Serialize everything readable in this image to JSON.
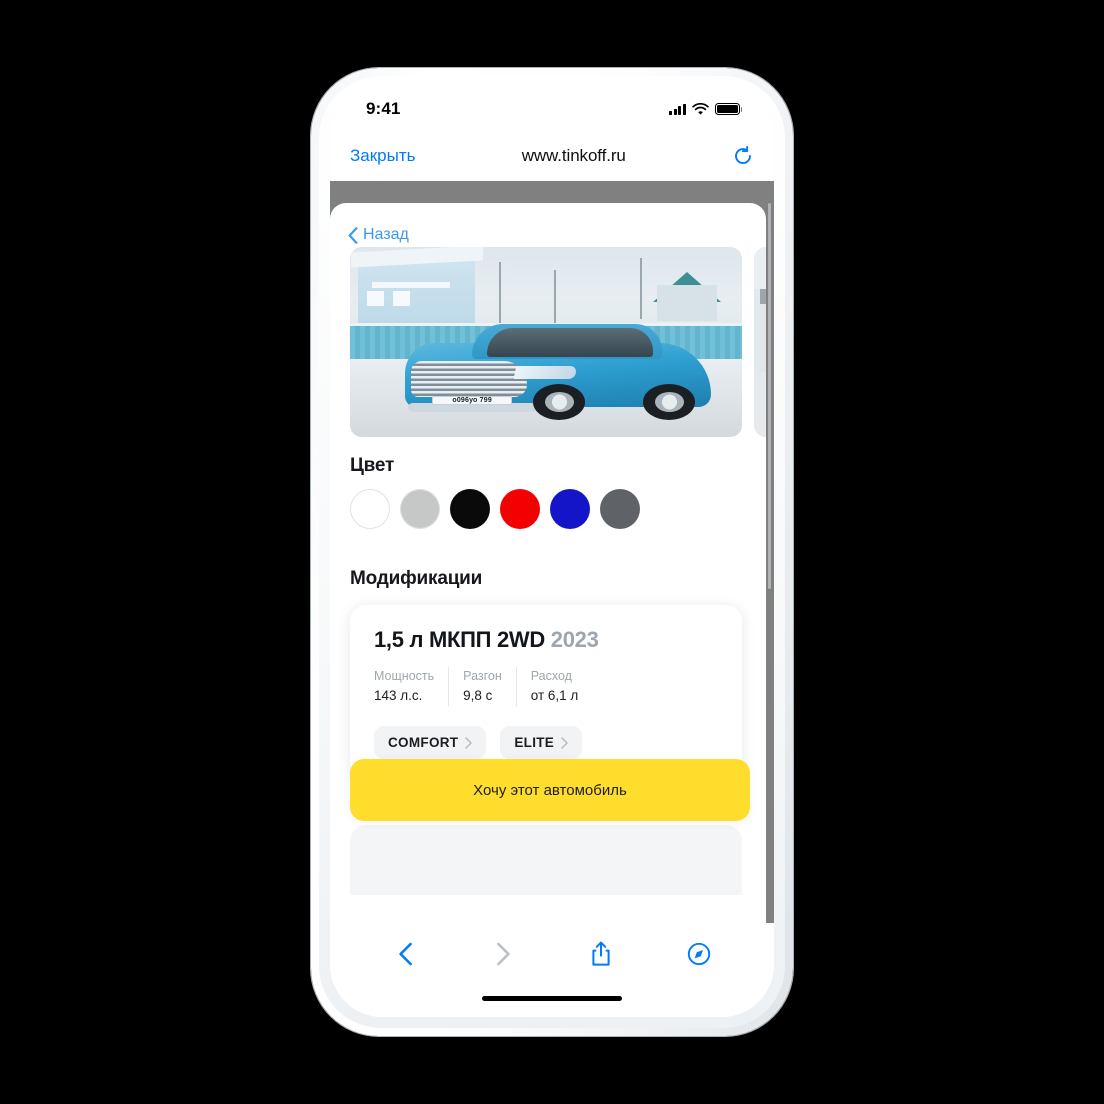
{
  "status_bar": {
    "time": "9:41",
    "signal_icon": "cellular-signal-icon",
    "wifi_icon": "wifi-icon",
    "battery_icon": "battery-full-icon"
  },
  "browser": {
    "close_label": "Закрыть",
    "url": "www.tinkoff.ru",
    "reload_icon": "reload-icon",
    "toolbar": {
      "back_icon": "chevron-left-icon",
      "forward_icon": "chevron-right-icon",
      "share_icon": "share-icon",
      "tabs_icon": "compass-icon"
    }
  },
  "page": {
    "back_link": "Назад",
    "gallery": {
      "main_photo_alt": "Синий внедорожник HAVAL на снегу",
      "license_plate": "о096уо 799",
      "next_photo_alt": "Вторая фотография автомобиля"
    },
    "colors": {
      "title": "Цвет",
      "swatches": [
        {
          "name": "white",
          "hex": "#ffffff"
        },
        {
          "name": "silver",
          "hex": "#c6c8c8"
        },
        {
          "name": "black",
          "hex": "#0a0a0a"
        },
        {
          "name": "red",
          "hex": "#f50000"
        },
        {
          "name": "blue",
          "hex": "#1414c8"
        },
        {
          "name": "gray",
          "hex": "#5f6367"
        }
      ]
    },
    "modifications": {
      "title": "Модификации",
      "card": {
        "name": "1,5 л МКПП 2WD",
        "year": "2023",
        "specs": [
          {
            "label": "Мощность",
            "value": "143 л.с."
          },
          {
            "label": "Разгон",
            "value": "9,8 с"
          },
          {
            "label": "Расход",
            "value": "от 6,1 л"
          }
        ],
        "trims": [
          {
            "label": "COMFORT"
          },
          {
            "label": "ELITE"
          }
        ]
      }
    },
    "cta": {
      "label": "Хочу этот автомобиль",
      "color": "#ffdd2d"
    },
    "accent_color": "#007aff"
  }
}
